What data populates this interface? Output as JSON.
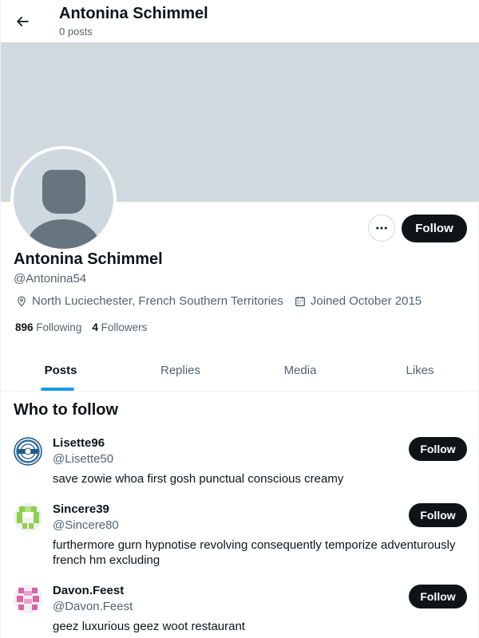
{
  "header": {
    "title": "Antonina Schimmel",
    "post_count": "0 posts",
    "back_icon": "arrow-left-icon"
  },
  "profile": {
    "name": "Antonina Schimmel",
    "handle": "@Antonina54",
    "location": "North Luciechester, French Southern Territories",
    "joined": "Joined October 2015",
    "following_count": "896",
    "following_label": "Following",
    "followers_count": "4",
    "followers_label": "Followers",
    "follow_label": "Follow",
    "more_icon": "more-horizontal-icon",
    "banner_color": "#cfd9de"
  },
  "tabs": [
    {
      "label": "Posts",
      "active": true
    },
    {
      "label": "Replies",
      "active": false
    },
    {
      "label": "Media",
      "active": false
    },
    {
      "label": "Likes",
      "active": false
    }
  ],
  "who_to_follow": {
    "title": "Who to follow",
    "suggestions": [
      {
        "name": "Lisette96",
        "handle": "@Lisette50",
        "bio": "save zowie whoa first gosh punctual conscious creamy",
        "follow_label": "Follow",
        "avatar": "circular-logo-avatar"
      },
      {
        "name": "Sincere39",
        "handle": "@Sincere80",
        "bio": "furthermore gurn hypnotise revolving consequently temporize adventurously french hm excluding",
        "follow_label": "Follow",
        "avatar": "green-identicon-avatar"
      },
      {
        "name": "Davon.Feest",
        "handle": "@Davon.Feest",
        "bio": "geez luxurious geez woot restaurant",
        "follow_label": "Follow",
        "avatar": "pink-identicon-avatar"
      }
    ]
  },
  "colors": {
    "accent": "#1d9bf0",
    "button_dark": "#0f1419",
    "secondary_text": "#536471"
  }
}
